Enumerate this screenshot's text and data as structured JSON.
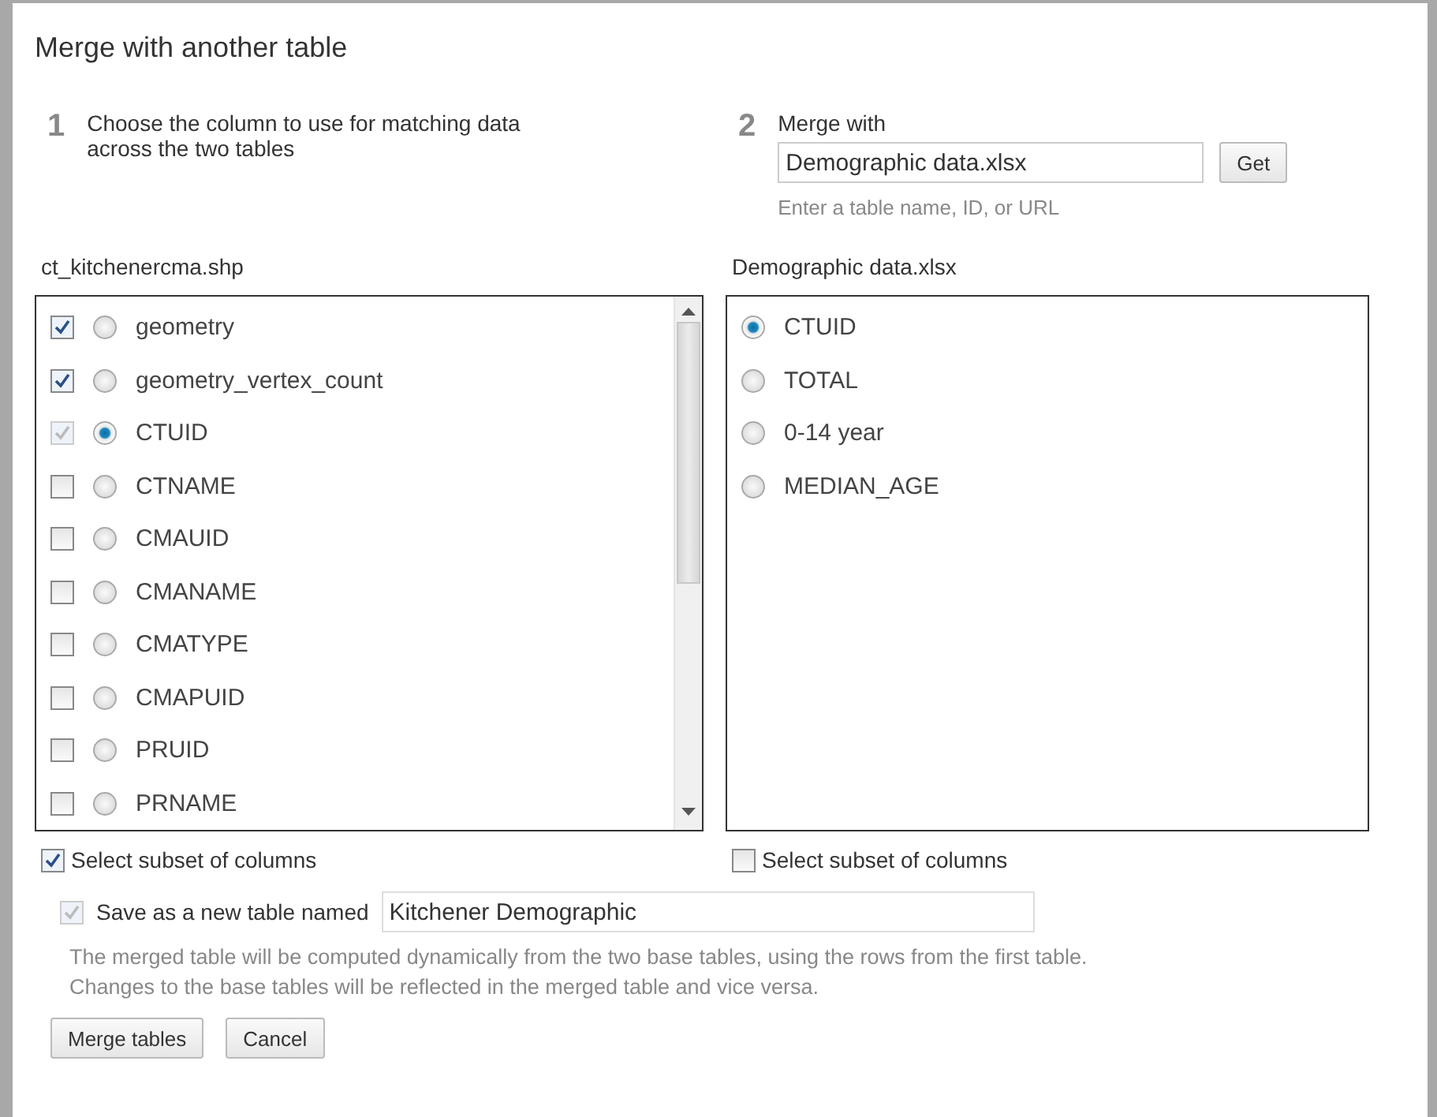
{
  "dialog": {
    "title": "Merge with another table"
  },
  "step1": {
    "number": "1",
    "text": "Choose the column to use for matching data across the two tables"
  },
  "step2": {
    "number": "2",
    "label": "Merge with",
    "value": "Demographic data.xlsx",
    "button": "Get",
    "hint": "Enter a table name, ID, or URL"
  },
  "left_table": {
    "name": "ct_kitchenercma.shp",
    "columns": [
      {
        "label": "geometry",
        "checked": true,
        "disabled": false,
        "selected": false
      },
      {
        "label": "geometry_vertex_count",
        "checked": true,
        "disabled": false,
        "selected": false
      },
      {
        "label": "CTUID",
        "checked": true,
        "disabled": true,
        "selected": true
      },
      {
        "label": "CTNAME",
        "checked": false,
        "disabled": false,
        "selected": false
      },
      {
        "label": "CMAUID",
        "checked": false,
        "disabled": false,
        "selected": false
      },
      {
        "label": "CMANAME",
        "checked": false,
        "disabled": false,
        "selected": false
      },
      {
        "label": "CMATYPE",
        "checked": false,
        "disabled": false,
        "selected": false
      },
      {
        "label": "CMAPUID",
        "checked": false,
        "disabled": false,
        "selected": false
      },
      {
        "label": "PRUID",
        "checked": false,
        "disabled": false,
        "selected": false
      },
      {
        "label": "PRNAME",
        "checked": false,
        "disabled": false,
        "selected": false
      }
    ],
    "subset": {
      "label": "Select subset of columns",
      "checked": true
    }
  },
  "right_table": {
    "name": "Demographic data.xlsx",
    "columns": [
      {
        "label": "CTUID",
        "selected": true
      },
      {
        "label": "TOTAL",
        "selected": false
      },
      {
        "label": "0-14 year",
        "selected": false
      },
      {
        "label": "MEDIAN_AGE",
        "selected": false
      }
    ],
    "subset": {
      "label": "Select subset of columns",
      "checked": false
    }
  },
  "save": {
    "label": "Save as a new table named",
    "checked": true,
    "disabled": true,
    "value": "Kitchener Demographic"
  },
  "note": "The merged table will be computed dynamically from the two base tables, using the rows from the first table. Changes to the base tables will be reflected in the merged table and vice versa.",
  "buttons": [
    "Merge tables",
    "Cancel"
  ]
}
